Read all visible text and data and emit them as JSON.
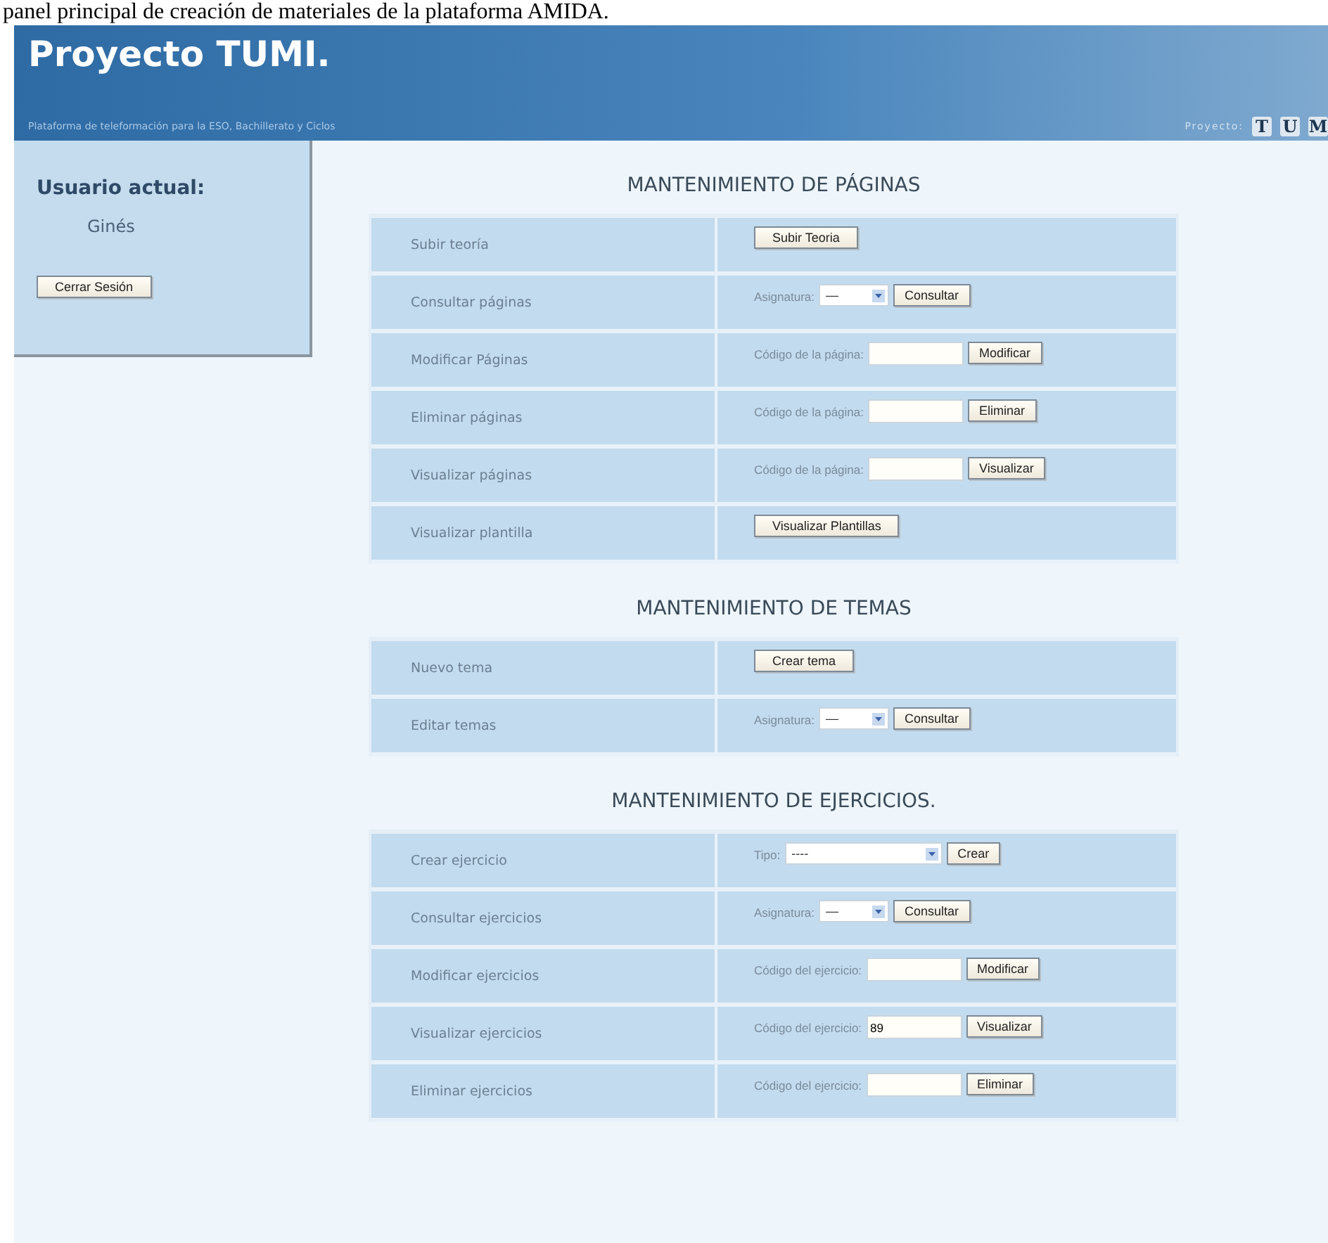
{
  "caption": "panel principal de creación de materiales de la plataforma AMIDA.",
  "header": {
    "title": "Proyecto TUMI.",
    "subtitle": "Plataforma de teleformación para la ESO, Bachillerato y Ciclos",
    "project_label": "Proyecto:",
    "logo_letters": [
      "T",
      "U",
      "M"
    ]
  },
  "sidebar": {
    "heading": "Usuario actual:",
    "user": "Ginés",
    "logout": "Cerrar Sesión"
  },
  "sections": [
    {
      "title": "MANTENIMIENTO DE PÁGINAS",
      "rows": [
        {
          "label": "Subir teoría",
          "action": {
            "kind": "button",
            "button": "Subir Teoria"
          }
        },
        {
          "label": "Consultar páginas",
          "action": {
            "kind": "select",
            "label": "Asignatura:",
            "value": "—",
            "button": "Consultar"
          }
        },
        {
          "label": "Modificar Páginas",
          "action": {
            "kind": "input",
            "label": "Código de la página:",
            "button": "Modificar"
          }
        },
        {
          "label": "Eliminar páginas",
          "action": {
            "kind": "input",
            "label": "Código de la página:",
            "button": "Eliminar"
          }
        },
        {
          "label": "Visualizar páginas",
          "action": {
            "kind": "input",
            "label": "Código de la página:",
            "button": "Visualizar"
          }
        },
        {
          "label": "Visualizar plantilla",
          "action": {
            "kind": "button",
            "button": "Visualizar Plantillas"
          }
        }
      ]
    },
    {
      "title": "MANTENIMIENTO DE TEMAS",
      "rows": [
        {
          "label": "Nuevo tema",
          "action": {
            "kind": "button",
            "button": "Crear tema"
          }
        },
        {
          "label": "Editar temas",
          "action": {
            "kind": "select",
            "label": "Asignatura:",
            "value": "—",
            "button": "Consultar"
          }
        }
      ]
    },
    {
      "title": "MANTENIMIENTO DE EJERCICIOS.",
      "rows": [
        {
          "label": "Crear ejercicio",
          "action": {
            "kind": "wide-select",
            "label": "Tipo:",
            "value": "----",
            "button": "Crear"
          }
        },
        {
          "label": "Consultar ejercicios",
          "action": {
            "kind": "select",
            "label": "Asignatura:",
            "value": "—",
            "button": "Consultar"
          }
        },
        {
          "label": "Modificar ejercicios",
          "action": {
            "kind": "input",
            "label": "Código del ejercicio:",
            "button": "Modificar"
          }
        },
        {
          "label": "Visualizar ejercicios",
          "action": {
            "kind": "input",
            "label": "Código del ejercicio:",
            "value": "89",
            "button": "Visualizar"
          }
        },
        {
          "label": "Eliminar ejercicios",
          "action": {
            "kind": "input",
            "label": "Código del ejercicio:",
            "button": "Eliminar"
          }
        }
      ]
    }
  ]
}
